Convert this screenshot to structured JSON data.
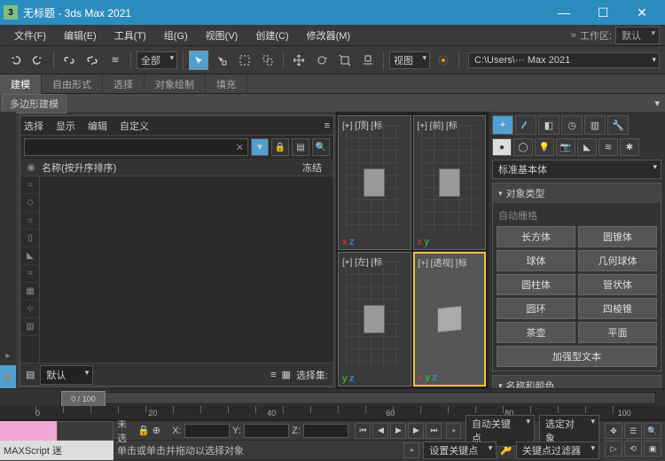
{
  "title": "无标题 - 3ds Max 2021",
  "menubar": [
    "文件(F)",
    "编辑(E)",
    "工具(T)",
    "组(G)",
    "视图(V)",
    "创建(C)",
    "修改器(M)"
  ],
  "workspace": {
    "label": "工作区:",
    "value": "默认"
  },
  "toolbar": {
    "all": "全部",
    "view": "视图",
    "path": "C:\\Users\\··· Max 2021"
  },
  "ribbon": [
    "建模",
    "自由形式",
    "选择",
    "对象绘制",
    "填充"
  ],
  "subribbon": "多边形建模",
  "scene": {
    "tabs": [
      "选择",
      "显示",
      "编辑",
      "自定义"
    ],
    "filter_x": "✕",
    "header_name": "名称(按升序排序)",
    "header_freeze": "冻结",
    "layer_default": "默认",
    "sel_set": "选择集:"
  },
  "viewports": {
    "top": "[+] [顶] [标",
    "front": "[+] [前] [标",
    "left": "[+] [左] [标",
    "persp": "[+] [透视] [标"
  },
  "cmd": {
    "category": "标准基本体",
    "rollout_type": "对象类型",
    "auto_grid": "自动栅格",
    "objects": [
      "长方体",
      "圆锥体",
      "球体",
      "几何球体",
      "圆柱体",
      "管状体",
      "圆环",
      "四棱锥",
      "茶壶",
      "平面",
      "加强型文本"
    ],
    "rollout_name": "名称和颜色"
  },
  "timeline": {
    "marker": "0 / 100"
  },
  "ruler": [
    "0",
    "20",
    "40",
    "60",
    "80",
    "100"
  ],
  "status": {
    "script": "MAXScript 迷",
    "undo": "未选",
    "prompt": "单击或单击并拖动以选择对象",
    "autokey": "自动关键点",
    "selkey": "选定对象",
    "setkey": "设置关键点",
    "keyfilter": "关键点过滤器"
  }
}
